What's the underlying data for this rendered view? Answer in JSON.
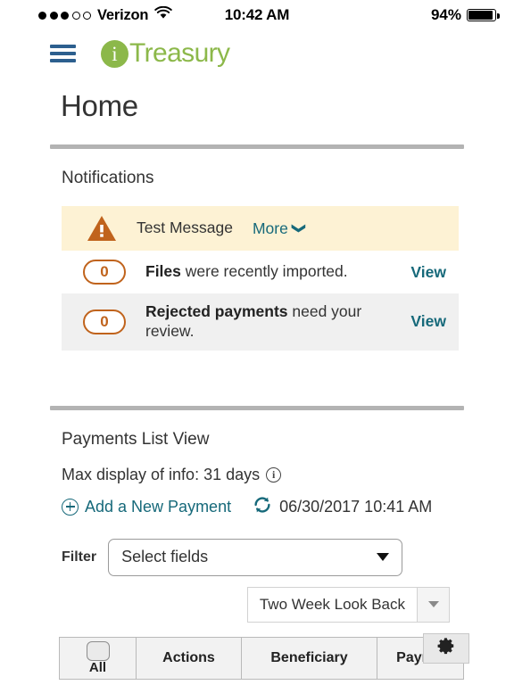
{
  "statusbar": {
    "carrier": "Verizon",
    "signal_dots_filled": 3,
    "signal_dots_total": 5,
    "wifi_icon": "wifi-icon",
    "time": "10:42 AM",
    "battery_percent": "94%",
    "battery_icon": "battery-icon"
  },
  "header": {
    "menu_icon": "hamburger-menu-icon",
    "logo_mark": "i",
    "logo_text": "Treasury",
    "brand_color": "#8cb84a",
    "menu_color": "#2c5f8e"
  },
  "page": {
    "title": "Home"
  },
  "notifications": {
    "section_title": "Notifications",
    "items": [
      {
        "type": "warning",
        "icon": "warning-triangle-icon",
        "message": "Test Message",
        "link_label": "More",
        "link_icon": "chevron-down-icon",
        "background": "#fdf2d4"
      },
      {
        "type": "count",
        "count": "0",
        "text_bold": "Files",
        "text_rest": " were recently imported.",
        "link_label": "View",
        "background": "#ffffff"
      },
      {
        "type": "count",
        "count": "0",
        "text_bold": "Rejected payments",
        "text_rest": " need your review.",
        "link_label": "View",
        "background": "#f0f0f0"
      }
    ],
    "accent_color": "#c0631c",
    "link_color": "#16697a"
  },
  "payments": {
    "section_title": "Payments List View",
    "max_display_label": "Max display of info: 31 days",
    "info_icon": "info-icon",
    "add_payment_label": "Add a New Payment",
    "add_payment_icon": "plus-circle-icon",
    "refresh_icon": "refresh-icon",
    "last_updated": "06/30/2017 10:41 AM",
    "filter_label": "Filter",
    "filter_value": "Select fields",
    "filter_caret_icon": "caret-down-icon",
    "lookback_value": "Two Week Look Back",
    "lookback_caret_icon": "caret-down-icon",
    "settings_icon": "gear-icon",
    "table_headers": [
      {
        "label": "All",
        "type": "checkbox"
      },
      {
        "label": "Actions",
        "type": "text"
      },
      {
        "label": "Beneficiary",
        "type": "text"
      },
      {
        "label": "Payment",
        "type": "text"
      }
    ]
  }
}
